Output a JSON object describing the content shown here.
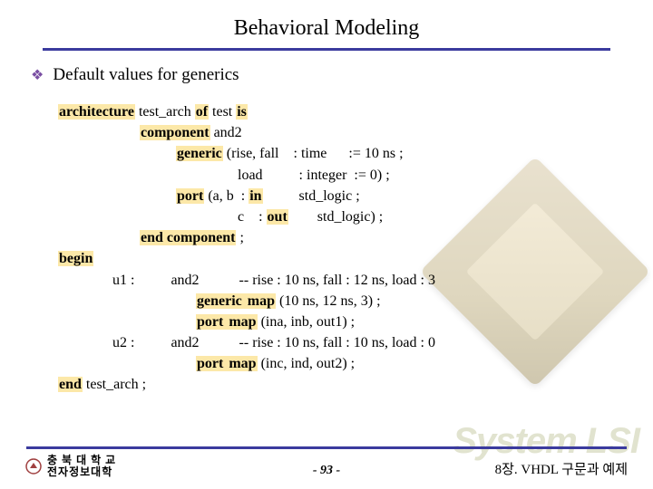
{
  "title": "Behavioral Modeling",
  "bullet": {
    "icon": "❖",
    "text": "Default values for generics"
  },
  "code": {
    "l1a": "architecture",
    "l1b": " test_arch ",
    "l1c": "of",
    "l1d": " test ",
    "l1e": "is",
    "l2a": "component",
    "l2b": " and2",
    "l3a": "generic",
    "l3b": " (rise, fall    : time      := 10 ns ;",
    "l4": "  load          : integer  := 0) ;",
    "l5a": "port",
    "l5b": " (a, b  : ",
    "l5c": "in",
    "l5d": "          std_logic ;",
    "l6a": "  c    : ",
    "l6b": "out",
    "l6c": "        std_logic) ;",
    "l7a": "end component",
    "l7b": " ;",
    "l8": "begin",
    "l9a": "u1 :          and2           -- rise : 10 ns, fall : 12 ns, load : 3",
    "l10a": "generic ",
    "l10b": "map",
    "l10c": " (10 ns, 12 ns, 3) ;",
    "l11a": "port ",
    "l11b": "map",
    "l11c": " (ina, inb, out1) ;",
    "l12a": "u2 :          and2           -- rise : 10 ns, fall : 10 ns, load : 0",
    "l13a": "port ",
    "l13b": "map",
    "l13c": " (inc, ind, out2) ;",
    "l14a": "end",
    "l14b": " test_arch ;"
  },
  "footer": {
    "left_line1": "충 북 대 학 교",
    "left_line2": "전자정보대학",
    "center": "-  93  -",
    "right": "8장.  VHDL 구문과 예제"
  },
  "logo": "System LSI"
}
